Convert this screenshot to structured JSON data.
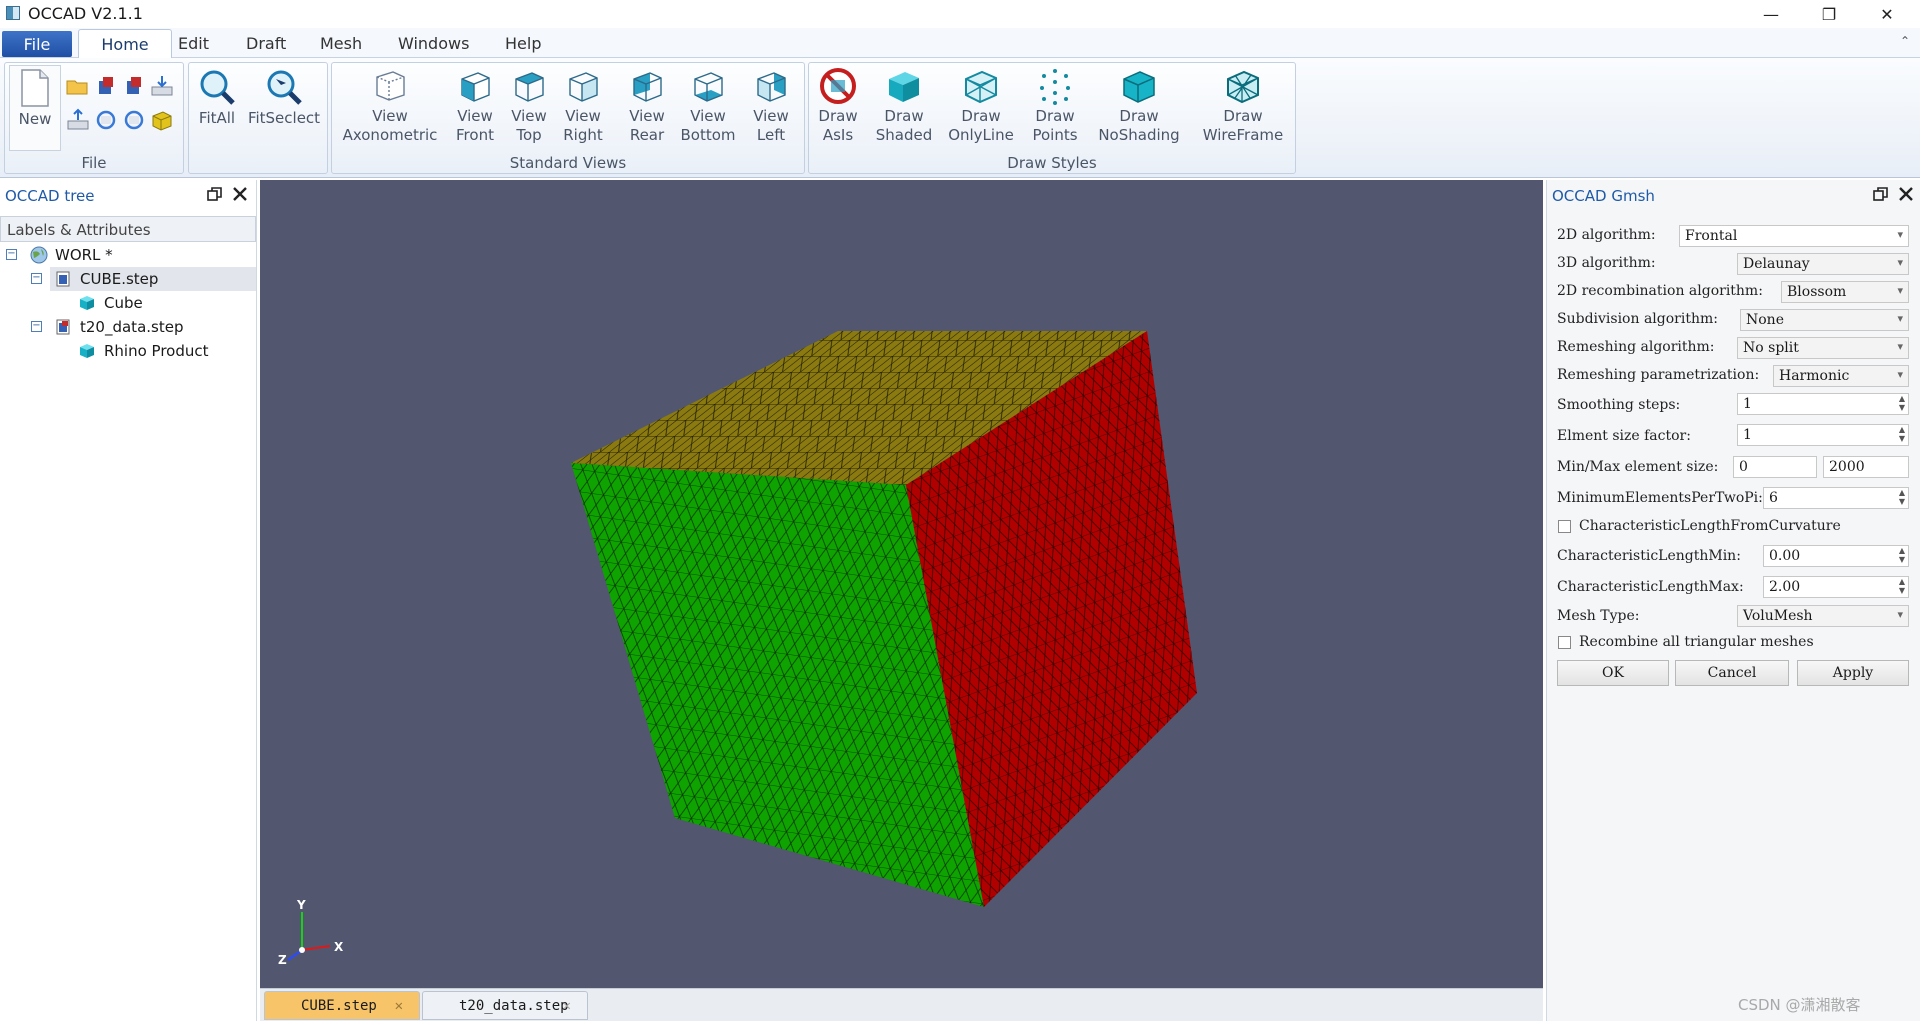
{
  "window": {
    "title": "OCCAD V2.1.1",
    "minimize": "—",
    "restore": "❐",
    "close": "✕"
  },
  "menu": {
    "file": "File",
    "home": "Home",
    "edit": "Edit",
    "draft": "Draft",
    "mesh": "Mesh",
    "windows": "Windows",
    "help": "Help"
  },
  "ribbon": {
    "file_group": {
      "label": "File",
      "new": "New"
    },
    "fit": {
      "fitall": "FitAll",
      "fitselect": "FitSeclect"
    },
    "views_group": {
      "label": "Standard Views",
      "axonometric": [
        "View",
        "Axonometric"
      ],
      "front": [
        "View",
        "Front"
      ],
      "top": [
        "View",
        "Top"
      ],
      "right": [
        "View",
        "Right"
      ],
      "rear": [
        "View",
        "Rear"
      ],
      "bottom": [
        "View",
        "Bottom"
      ],
      "left": [
        "View",
        "Left"
      ]
    },
    "styles_group": {
      "label": "Draw Styles",
      "asis": [
        "Draw",
        "AsIs"
      ],
      "shaded": [
        "Draw",
        "Shaded"
      ],
      "onlyline": [
        "Draw",
        "OnlyLine"
      ],
      "points": [
        "Draw",
        "Points"
      ],
      "noshading": [
        "Draw",
        "NoShading"
      ],
      "wireframe": [
        "Draw",
        "WireFrame"
      ]
    }
  },
  "tree_panel": {
    "title": "OCCAD tree",
    "header": "Labels & Attributes",
    "items": [
      {
        "label": "WORL *",
        "icon": "globe-icon"
      },
      {
        "label": "CUBE.step",
        "icon": "document-icon"
      },
      {
        "label": "Cube",
        "icon": "cube-icon"
      },
      {
        "label": "t20_data.step",
        "icon": "document-icon"
      },
      {
        "label": "Rhino Product",
        "icon": "cube-icon"
      }
    ]
  },
  "viewport": {
    "axes": {
      "x": "X",
      "y": "Y",
      "z": "Z"
    },
    "colors": {
      "background": "#52566f",
      "front_face": "#0ea300",
      "right_face": "#b10000",
      "top_face": "#8a7a10"
    }
  },
  "doc_tabs": [
    {
      "label": "CUBE.step",
      "active": true
    },
    {
      "label": "t20_data.step",
      "active": false
    }
  ],
  "gmsh_panel": {
    "title": "OCCAD Gmsh",
    "algo2d": {
      "label": "2D algorithm:",
      "value": "Frontal"
    },
    "algo3d": {
      "label": "3D algorithm:",
      "value": "Delaunay"
    },
    "recomb2d": {
      "label": "2D recombination algorithm:",
      "value": "Blossom"
    },
    "subdiv": {
      "label": "Subdivision algorithm:",
      "value": "None"
    },
    "remesh_algo": {
      "label": "Remeshing algorithm:",
      "value": "No split"
    },
    "remesh_param": {
      "label": "Remeshing parametrization:",
      "value": "Harmonic"
    },
    "smoothing": {
      "label": "Smoothing steps:",
      "value": "1"
    },
    "size_factor": {
      "label": "Elment size factor:",
      "value": "1"
    },
    "minmax": {
      "label": "Min/Max element size:",
      "min": "0",
      "max": "2000"
    },
    "min_per_2pi": {
      "label": "MinimumElementsPerTwoPi:",
      "value": "6"
    },
    "char_from_curv": {
      "label": "CharacteristicLengthFromCurvature"
    },
    "char_min": {
      "label": "CharacteristicLengthMin:",
      "value": "0.00"
    },
    "char_max": {
      "label": "CharacteristicLengthMax:",
      "value": "2.00"
    },
    "mesh_type": {
      "label": "Mesh Type:",
      "value": "VoluMesh"
    },
    "recombine_all": {
      "label": "Recombine all triangular meshes"
    },
    "buttons": {
      "ok": "OK",
      "cancel": "Cancel",
      "apply": "Apply"
    }
  },
  "watermark": "CSDN @潇湘散客"
}
